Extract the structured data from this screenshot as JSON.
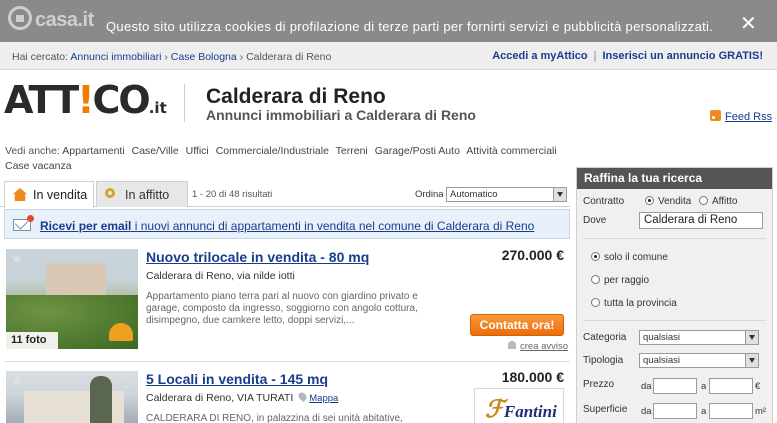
{
  "cookie": {
    "logo_text": "casa.it",
    "message": "Questo sito utilizza cookies di profilazione di terze parti per fornirti servizi e pubblicità personalizzati.",
    "close_glyph": "✕"
  },
  "breadcrumb": {
    "prefix": "Hai cercato:",
    "items": [
      "Annunci immobiliari",
      "Case Bologna",
      "Calderara di Reno"
    ],
    "separator": "›"
  },
  "top_links": {
    "account": "Accedi a myAttico",
    "separator": "|",
    "insert": "Inserisci un annuncio GRATIS!"
  },
  "brand": {
    "part1": "ATT",
    "ex": "!",
    "part2": "CO",
    "suffix": ".it"
  },
  "header": {
    "title": "Calderara di Reno",
    "subtitle": "Annunci immobiliari a Calderara di Reno",
    "feed": "Feed Rss"
  },
  "vedi_anche": {
    "label": "Vedi anche:",
    "links": [
      "Appartamenti",
      "Case/Ville",
      "Uffici",
      "Commerciale/Industriale",
      "Terreni",
      "Garage/Posti Auto",
      "Attività commerciali",
      "Case vacanza"
    ]
  },
  "tabs": {
    "sale": "In vendita",
    "rent": "In affitto",
    "results": "1 - 20 di 48 risultati",
    "order_label": "Ordina",
    "order_value": "Automatico"
  },
  "alert": {
    "bold": "Ricevi per email",
    "rest": " i nuovi annunci di appartamenti in vendita nel comune di Calderara di Reno"
  },
  "listings": [
    {
      "title": "Nuovo trilocale in vendita - 80 mq",
      "price": "270.000 €",
      "address": "Calderara di Reno, via nilde iotti",
      "description": "Appartamento piano terra pari al nuovo con giardino privato e garage, composto da ingresso, soggiorno con angolo cottura, disimpegno, due camkere letto, doppi servizi,...",
      "photos": "11 foto",
      "contact": "Contatta ora!",
      "alert": "crea avviso"
    },
    {
      "title": "5 Locali in vendita - 145 mq",
      "price": "180.000 €",
      "address": "Calderara di Reno, VIA TURATI",
      "map": "Mappa",
      "description": "CALDERARA DI RENO, in palazzina di sei unità abitative, vendiamo",
      "agency": "Fantini"
    }
  ],
  "sidebar": {
    "title": "Raffina la tua ricerca",
    "contratto_label": "Contratto",
    "contratto_options": [
      "Vendita",
      "Affitto"
    ],
    "dove_label": "Dove",
    "dove_value": "Calderara di Reno",
    "scope_options": [
      "solo il comune",
      "per raggio",
      "tutta la provincia"
    ],
    "categoria_label": "Categoria",
    "categoria_value": "qualsiasi",
    "tipologia_label": "Tipologia",
    "tipologia_value": "qualsiasi",
    "prezzo_label": "Prezzo",
    "superficie_label": "Superficie",
    "da": "da",
    "a": "a",
    "euro": "€",
    "mq": "m²"
  },
  "icons": {
    "logo": "house-circle-icon",
    "rss": "rss-icon",
    "sale_tab": "house-icon",
    "rent_tab": "key-icon",
    "email": "envelope-icon",
    "favorite": "star-icon",
    "pin": "map-pin-icon",
    "bell": "bell-icon"
  },
  "colors": {
    "accent": "#f07d00",
    "link": "#1a3c8c",
    "cookie_bar": "#8a8a8a",
    "sidebar_header": "#555555"
  }
}
